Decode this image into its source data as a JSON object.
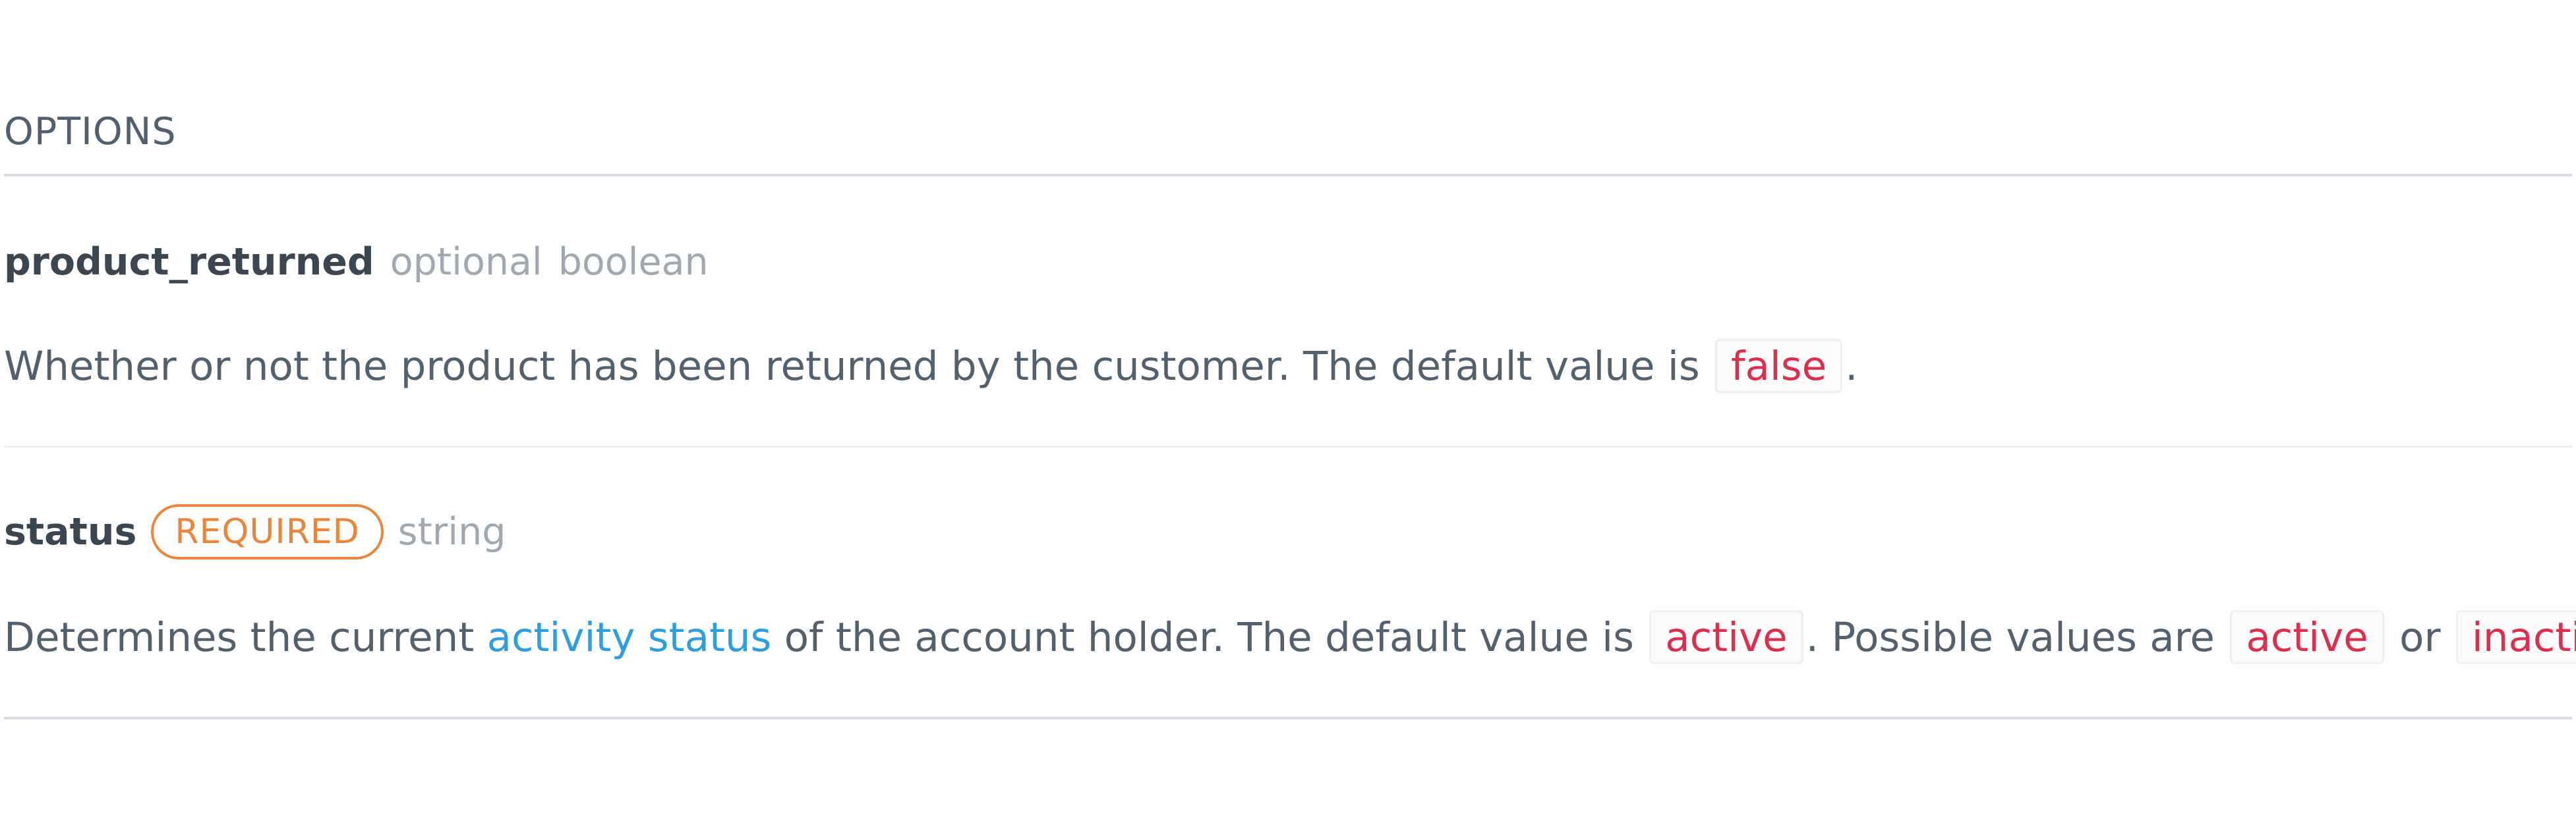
{
  "section": {
    "title": "OPTIONS"
  },
  "params": [
    {
      "name": "product_returned",
      "optional_label": "optional",
      "type": "boolean",
      "description": {
        "text1": "Whether or not the product has been returned by the customer. The default value is ",
        "default_value": "false",
        "text2": "."
      }
    },
    {
      "name": "status",
      "required_label": "REQUIRED",
      "type": "string",
      "description": {
        "text1": "Determines the current ",
        "link_text": "activity status",
        "text2": " of the account holder. The default value is ",
        "default_value": "active",
        "text3": ". Possible values are ",
        "value_a": "active",
        "text4": " or ",
        "value_b": "inactive",
        "text5": "."
      }
    }
  ],
  "colors": {
    "required_badge": "#e8873c",
    "code_text": "#dc2f4f",
    "link": "#2f9edc"
  }
}
